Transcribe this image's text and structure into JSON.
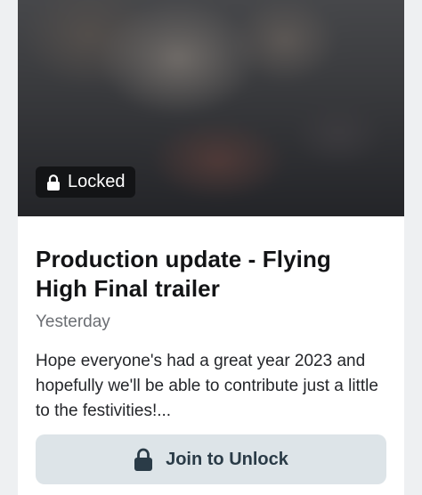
{
  "post": {
    "locked_label": "Locked",
    "title": "Production update - Flying High Final trailer",
    "date": "Yesterday",
    "excerpt": "Hope everyone's had a great year 2023 and hopefully we'll be able to contribute just a little to the festivities!...",
    "unlock_label": "Join to Unlock"
  },
  "icons": {
    "badge_icon": "lock-icon",
    "button_icon": "lock-icon"
  },
  "colors": {
    "badge_bg": "#131416",
    "button_bg": "#dde4e8",
    "button_text": "#2a3b47",
    "title_text": "#131416",
    "date_text": "#6b6e73"
  }
}
